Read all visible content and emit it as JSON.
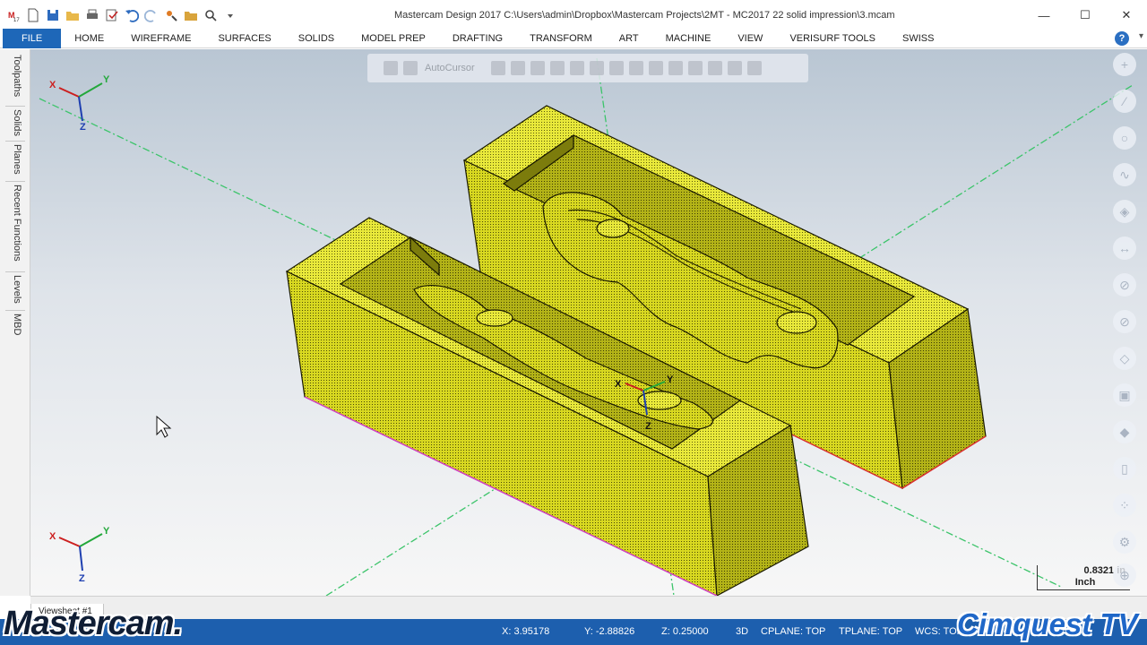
{
  "window": {
    "title": "Mastercam Design 2017  C:\\Users\\admin\\Dropbox\\Mastercam Projects\\2MT - MC2017 22 solid impression\\3.mcam",
    "minimize": "—",
    "maximize": "☐",
    "close": "✕"
  },
  "ribbon": {
    "tabs": [
      "FILE",
      "HOME",
      "WIREFRAME",
      "SURFACES",
      "SOLIDS",
      "MODEL PREP",
      "DRAFTING",
      "TRANSFORM",
      "ART",
      "MACHINE",
      "VIEW",
      "VERISURF TOOLS",
      "SWISS"
    ],
    "help": "?"
  },
  "left_tabs": [
    "Toolpaths",
    "Solids",
    "Planes",
    "Recent Functions",
    "Levels",
    "MBD"
  ],
  "floating_toolbar": {
    "autocursor_label": "AutoCursor"
  },
  "gnomon": {
    "x": "X",
    "y": "Y",
    "z": "Z"
  },
  "scale": {
    "value": "0.8321 in",
    "unit": "Inch"
  },
  "sheet_tab": "Viewsheet #1",
  "status": {
    "x": "X:  3.95178",
    "y": "Y:  -2.88826",
    "z": "Z:  0.25000",
    "mode": "3D",
    "cplane": "CPLANE: TOP",
    "tplane": "TPLANE: TOP",
    "wcs": "WCS: TOP"
  },
  "watermarks": {
    "left": "Mastercam.",
    "right": "Cimquest TV"
  },
  "colors": {
    "ribbon_file": "#1e67b8",
    "status_bar": "#1d5fae",
    "solid_fill": "#d4d41c",
    "axis_red": "#cc1f1f",
    "axis_green": "#23a83b",
    "axis_blue": "#1e3fb0"
  }
}
